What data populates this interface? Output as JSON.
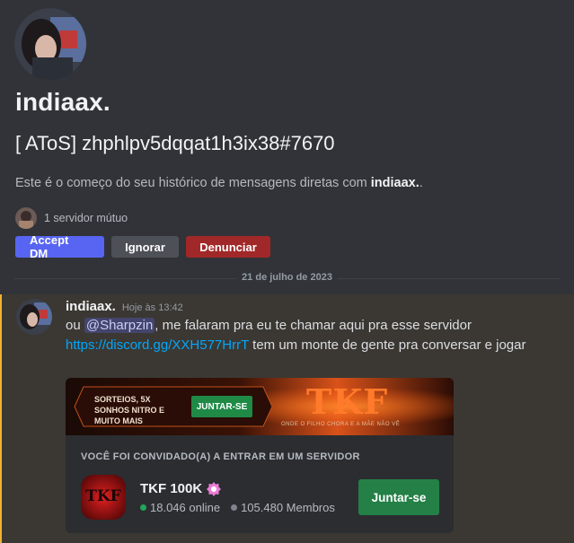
{
  "profile": {
    "username": "indiaax.",
    "display_name": "[ AToS] zhphlpv5dqqat1h3ix38#7670",
    "intro_prefix": "Este é o começo do seu histórico de mensagens diretas com ",
    "intro_name": "indiaax.",
    "intro_suffix": ".",
    "mutual_servers": "1 servidor mútuo"
  },
  "actions": {
    "accept": "Accept DM",
    "ignore": "Ignorar",
    "report": "Denunciar"
  },
  "date_divider": "21 de julho de 2023",
  "message": {
    "author": "indiaax.",
    "timestamp": "Hoje às 13:42",
    "text_1": "ou ",
    "mention": "@Sharpzin",
    "text_2": ", me falaram pra eu te chamar aqui pra esse servidor ",
    "link": "https://discord.gg/XXH577HrrT",
    "text_3": " tem um monte de gente pra conversar e jogar"
  },
  "invite": {
    "banner_promo": "SORTEIOS, 5X SONHOS NITRO E MUITO MAIS",
    "banner_button": "JUNTAR-SE",
    "banner_logo": "TKF",
    "banner_tagline": "ONDE O FILHO CHORA E A MÃE NÃO VÊ",
    "label": "VOCÊ FOI CONVIDADO(A) A ENTRAR EM UM SERVIDOR",
    "server_name": "TKF 100K",
    "online": "18.046 online",
    "members": "105.480 Membros",
    "join": "Juntar-se",
    "icon_letters": "TKF"
  },
  "colors": {
    "accent": "#5865f2",
    "danger": "#a12828",
    "online": "#23a55a",
    "highlight_bar": "#f0b232"
  }
}
